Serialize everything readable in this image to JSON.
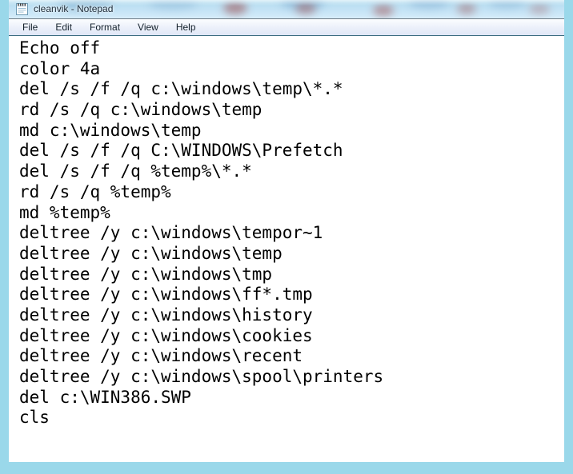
{
  "window": {
    "title": "cleanvik - Notepad",
    "icon": "notepad-icon",
    "accent_color": "#9ad8ea",
    "titlebar_color": "#bcdff2",
    "text_color": "#000000",
    "background_color": "#ffffff"
  },
  "menubar": {
    "items": [
      {
        "label": "File"
      },
      {
        "label": "Edit"
      },
      {
        "label": "Format"
      },
      {
        "label": "View"
      },
      {
        "label": "Help"
      }
    ]
  },
  "editor": {
    "lines": [
      "Echo off",
      "color 4a",
      "del /s /f /q c:\\windows\\temp\\*.*",
      "rd /s /q c:\\windows\\temp",
      "md c:\\windows\\temp",
      "del /s /f /q C:\\WINDOWS\\Prefetch",
      "del /s /f /q %temp%\\*.*",
      "rd /s /q %temp%",
      "md %temp%",
      "deltree /y c:\\windows\\tempor~1",
      "deltree /y c:\\windows\\temp",
      "deltree /y c:\\windows\\tmp",
      "deltree /y c:\\windows\\ff*.tmp",
      "deltree /y c:\\windows\\history",
      "deltree /y c:\\windows\\cookies",
      "deltree /y c:\\windows\\recent",
      "deltree /y c:\\windows\\spool\\printers",
      "del c:\\WIN386.SWP",
      "cls",
      ""
    ]
  }
}
